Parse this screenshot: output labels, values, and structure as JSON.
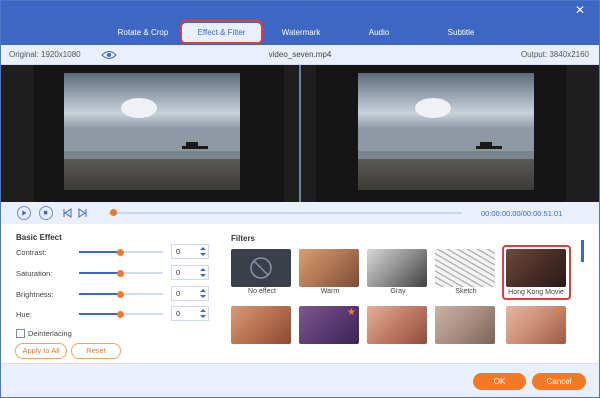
{
  "tabs": [
    {
      "label": "Rotate & Crop",
      "active": false
    },
    {
      "label": "Effect & Filter",
      "active": true
    },
    {
      "label": "Watermark",
      "active": false
    },
    {
      "label": "Audio",
      "active": false
    },
    {
      "label": "Subtitle",
      "active": false
    }
  ],
  "icons": {
    "close": "close-icon",
    "eye": "eye-icon",
    "play": "play-icon",
    "stop": "stop-icon",
    "prev": "previous-frame-icon",
    "next": "next-frame-icon",
    "no_effect": "no-effect-icon"
  },
  "info": {
    "original": "Original: 1920x1080",
    "filename": "video_seven.mp4",
    "output": "Output: 3840x2160"
  },
  "playback": {
    "timecode": "00:00:00.00/00:00:51.01",
    "progress": 0.0
  },
  "basic_effect": {
    "title": "Basic Effect",
    "sliders": [
      {
        "label": "Contrast:",
        "value": "0",
        "level": 0.5
      },
      {
        "label": "Saturation:",
        "value": "0",
        "level": 0.5
      },
      {
        "label": "Brightness:",
        "value": "0",
        "level": 0.5
      },
      {
        "label": "Hue:",
        "value": "0",
        "level": 0.5
      }
    ],
    "deinterlacing_label": "Deinterlacing",
    "deinterlacing_checked": false,
    "apply_all_label": "Apply to All",
    "reset_label": "Reset"
  },
  "filters": {
    "title": "Filters",
    "row1": [
      {
        "label": "No effect"
      },
      {
        "label": "Warm"
      },
      {
        "label": "Gray"
      },
      {
        "label": "Sketch"
      },
      {
        "label": "Hong Kong Movie"
      }
    ],
    "selected": "Hong Kong Movie"
  },
  "footer": {
    "ok_label": "OK",
    "cancel_label": "Cancel"
  },
  "colors": {
    "accent": "#3e67c4",
    "orange": "#f07a27",
    "highlight": "#e23b3b"
  }
}
